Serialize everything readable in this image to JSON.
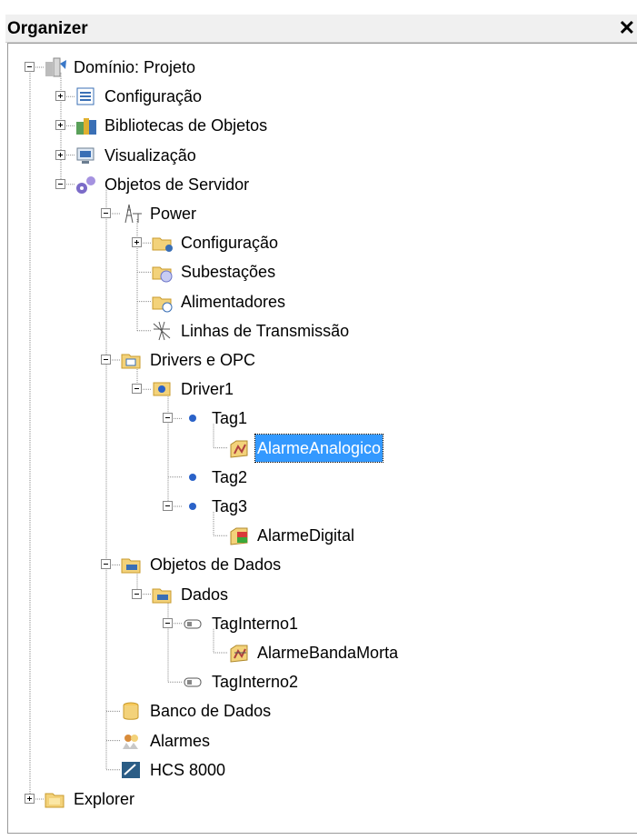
{
  "panel": {
    "title": "Organizer",
    "close_glyph": "✕"
  },
  "tree": [
    {
      "label": "Domínio: Projeto",
      "icon": "domain-icon",
      "expander": "minus",
      "level": 0
    },
    {
      "label": "Configuração",
      "icon": "configuration-list-icon",
      "expander": "plus",
      "level": 1
    },
    {
      "label": "Bibliotecas de Objetos",
      "icon": "object-library-icon",
      "expander": "plus",
      "level": 1
    },
    {
      "label": "Visualização",
      "icon": "monitor-icon",
      "expander": "plus",
      "level": 1
    },
    {
      "label": "Objetos de Servidor",
      "icon": "server-objects-gear-icon",
      "expander": "minus",
      "level": 1
    },
    {
      "label": "Power",
      "icon": "power-tower-icon",
      "expander": "minus",
      "level": 2
    },
    {
      "label": "Configuração",
      "icon": "power-config-folder-icon",
      "expander": "plus",
      "level": 3
    },
    {
      "label": "Subestações",
      "icon": "substation-folder-icon",
      "expander": null,
      "level": 3
    },
    {
      "label": "Alimentadores",
      "icon": "feeder-folder-icon",
      "expander": null,
      "level": 3
    },
    {
      "label": "Linhas de Transmissão",
      "icon": "transmission-line-icon",
      "expander": null,
      "level": 3
    },
    {
      "label": "Drivers e OPC",
      "icon": "drivers-folder-icon",
      "expander": "minus",
      "level": 2
    },
    {
      "label": "Driver1",
      "icon": "driver-icon",
      "expander": "minus",
      "level": 3
    },
    {
      "label": "Tag1",
      "icon": "tag-dot-icon",
      "expander": "minus",
      "level": 4
    },
    {
      "label": "AlarmeAnalogico",
      "icon": "analog-alarm-icon",
      "expander": null,
      "level": 5,
      "selected": true
    },
    {
      "label": "Tag2",
      "icon": "tag-dot-icon",
      "expander": null,
      "level": 4
    },
    {
      "label": "Tag3",
      "icon": "tag-dot-icon",
      "expander": "minus",
      "level": 4
    },
    {
      "label": "AlarmeDigital",
      "icon": "digital-alarm-icon",
      "expander": null,
      "level": 5
    },
    {
      "label": "Objetos de Dados",
      "icon": "data-objects-folder-icon",
      "expander": "minus",
      "level": 2
    },
    {
      "label": "Dados",
      "icon": "data-folder-icon",
      "expander": "minus",
      "level": 3
    },
    {
      "label": "TagInterno1",
      "icon": "internal-tag-icon",
      "expander": "minus",
      "level": 4
    },
    {
      "label": "AlarmeBandaMorta",
      "icon": "deadband-alarm-icon",
      "expander": null,
      "level": 5
    },
    {
      "label": "TagInterno2",
      "icon": "internal-tag-icon",
      "expander": null,
      "level": 4
    },
    {
      "label": "Banco de Dados",
      "icon": "database-icon",
      "expander": null,
      "level": 2
    },
    {
      "label": "Alarmes",
      "icon": "alarms-icon",
      "expander": null,
      "level": 2
    },
    {
      "label": "HCS 8000",
      "icon": "hcs-device-icon",
      "expander": null,
      "level": 2
    },
    {
      "label": "Explorer",
      "icon": "explorer-folder-icon",
      "expander": "plus",
      "level": 0
    }
  ]
}
